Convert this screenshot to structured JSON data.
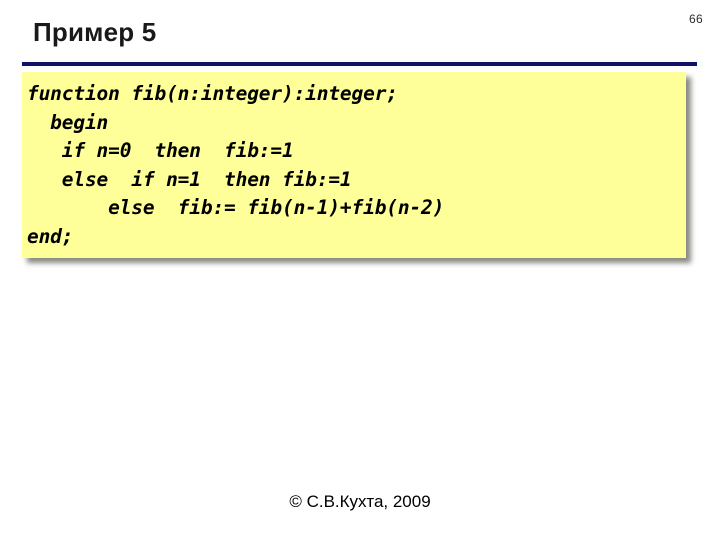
{
  "slide": {
    "background_color": "#ffffff",
    "page_number": "66",
    "title": "Пример 5",
    "divider_color": "#111166",
    "footer": "© С.В.Кухта, 2009"
  },
  "code_card": {
    "background_color": "#ffff99",
    "language": "pascal",
    "lines": [
      "function fib(n:integer):integer;",
      "  begin",
      "   if n=0  then  fib:=1",
      "   else  if n=1  then fib:=1",
      "       else  fib:= fib(n-1)+fib(n-2)",
      "end;"
    ],
    "text": "function fib(n:integer):integer;\n  begin\n   if n=0  then  fib:=1\n   else  if n=1  then fib:=1\n       else  fib:= fib(n-1)+fib(n-2)\nend;"
  }
}
